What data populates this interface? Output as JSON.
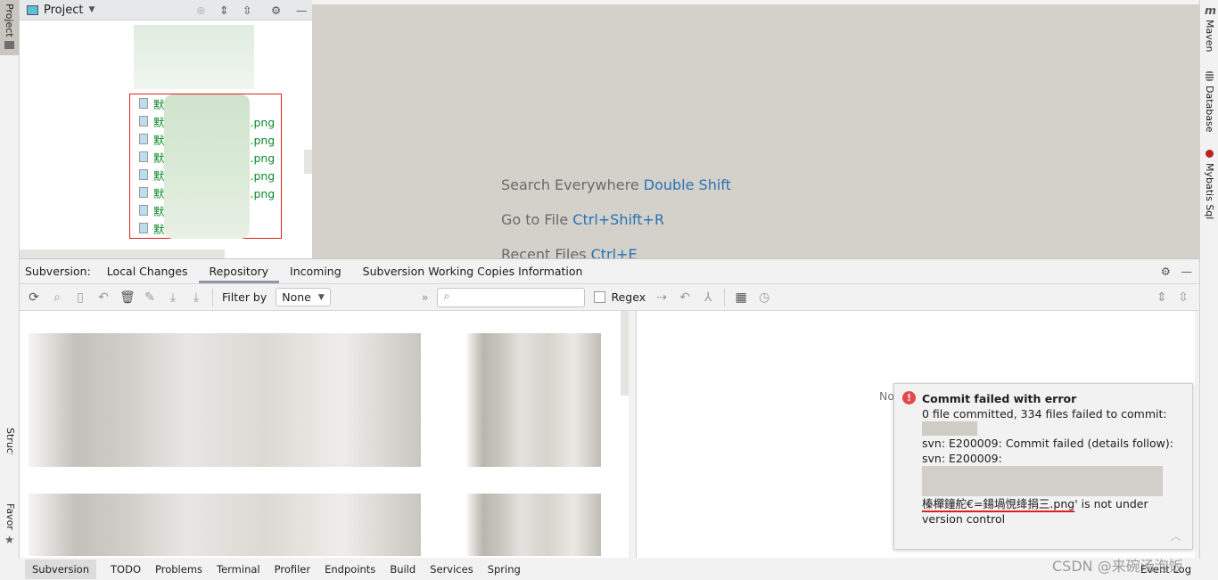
{
  "left_strip": {
    "project": "Project",
    "structure": "Structure",
    "favorites": "Favorites"
  },
  "right_strip": {
    "maven": "Maven",
    "database": "Database",
    "mybatis": "Mybatis Sql"
  },
  "project_panel": {
    "title": "Project",
    "files": [
      "默",
      "默 .png",
      "默 .png",
      "默 .png",
      "默 .png",
      "默 .png",
      "默",
      "默"
    ]
  },
  "editor": {
    "hints": [
      {
        "label": "Search Everywhere",
        "key": "Double Shift"
      },
      {
        "label": "Go to File",
        "key": "Ctrl+Shift+R"
      },
      {
        "label": "Recent Files",
        "key": "Ctrl+E"
      }
    ]
  },
  "tool_window": {
    "prefix": "Subversion:",
    "tabs": [
      {
        "label": "Local Changes"
      },
      {
        "label": "Repository",
        "active": true
      },
      {
        "label": "Incoming"
      },
      {
        "label": "Subversion Working Copies Information"
      }
    ],
    "filter_label": "Filter by",
    "filter_value": "None",
    "search_placeholder": "",
    "regex_label": "Regex",
    "detail_text": "No"
  },
  "notification": {
    "title": "Commit failed with error",
    "line1": "0 file committed, 334 files failed to commit:",
    "line2": "svn: E200009: Commit failed (details follow):",
    "line3": "svn: E200009:",
    "file": "榛樿鐘舵€=鍚堝悓绛捐三.png",
    "line4": "' is not under",
    "line5": "version control",
    "error_color": "#e5484d"
  },
  "status_bar": {
    "items": [
      "Subversion",
      "TODO",
      "Problems",
      "Terminal",
      "Profiler",
      "Endpoints",
      "Build",
      "Services",
      "Spring"
    ],
    "event_log": "Event Log",
    "watermark": "CSDN @来碗汤泡饭"
  }
}
